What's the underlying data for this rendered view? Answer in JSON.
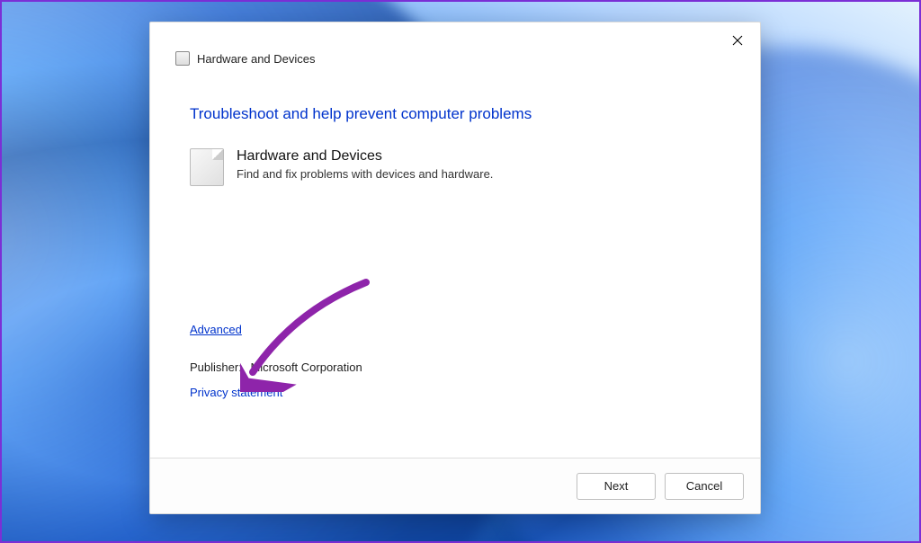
{
  "window_title": "Hardware and Devices",
  "main_heading": "Troubleshoot and help prevent computer problems",
  "troubleshooter": {
    "title": "Hardware and Devices",
    "description": "Find and fix problems with devices and hardware."
  },
  "links": {
    "advanced": "Advanced",
    "privacy": "Privacy statement"
  },
  "publisher": {
    "label": "Publisher:",
    "value": "Microsoft Corporation"
  },
  "buttons": {
    "next": "Next",
    "cancel": "Cancel"
  }
}
